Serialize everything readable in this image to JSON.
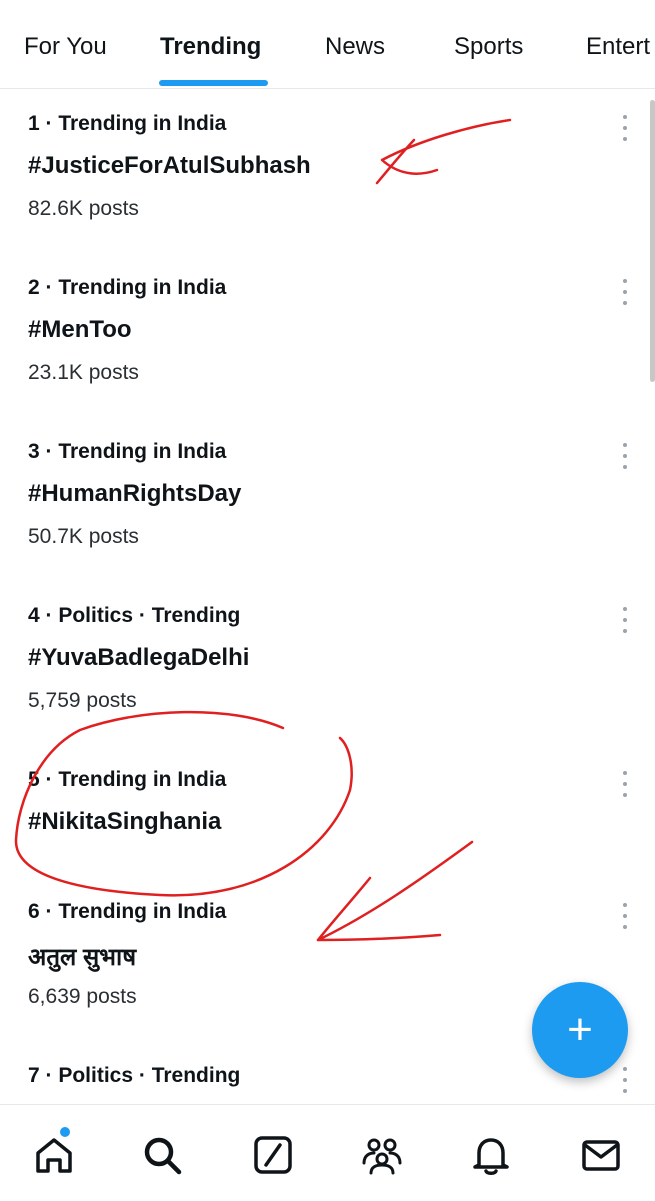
{
  "tabs": [
    {
      "label": "For You",
      "active": false
    },
    {
      "label": "Trending",
      "active": true
    },
    {
      "label": "News",
      "active": false
    },
    {
      "label": "Sports",
      "active": false
    },
    {
      "label": "Entert",
      "active": false
    }
  ],
  "trends": [
    {
      "context": "1 · Trending in India",
      "name": "#JusticeForAtulSubhash",
      "count": "82.6K posts"
    },
    {
      "context": "2 · Trending in India",
      "name": "#MenToo",
      "count": "23.1K posts"
    },
    {
      "context": "3 · Trending in India",
      "name": "#HumanRightsDay",
      "count": "50.7K posts"
    },
    {
      "context": "4 · Politics · Trending",
      "name": "#YuvaBadlegaDelhi",
      "count": "5,759 posts"
    },
    {
      "context": "5 · Trending in India",
      "name": "#NikitaSinghania",
      "count": ""
    },
    {
      "context": "6 · Trending in India",
      "name": "अतुल सुभाष",
      "count": "6,639 posts"
    },
    {
      "context": "7 · Politics · Trending",
      "name": "",
      "count": ""
    }
  ],
  "fab": {
    "glyph": "+"
  },
  "bottom_nav": [
    {
      "icon": "home-icon",
      "has_notification_dot": true
    },
    {
      "icon": "search-icon"
    },
    {
      "icon": "grok-icon"
    },
    {
      "icon": "communities-icon"
    },
    {
      "icon": "bell-icon"
    },
    {
      "icon": "mail-icon"
    }
  ],
  "colors": {
    "accent": "#1d9bf0",
    "annotation": "#e02020",
    "text": "#0f1419"
  }
}
